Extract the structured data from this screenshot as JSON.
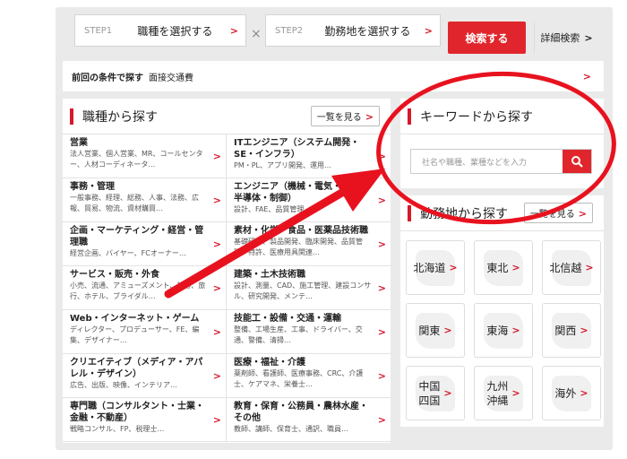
{
  "top": {
    "step1_no": "STEP1",
    "step1_label": "職種を選択する",
    "times": "×",
    "step2_no": "STEP2",
    "step2_label": "勤務地を選択する",
    "search": "検索する",
    "detail": "詳細検索"
  },
  "prev": {
    "label": "前回の条件で探す",
    "value": "面接交通費"
  },
  "jobs": {
    "title": "職種から探す",
    "more": "一覧を見る",
    "items": [
      {
        "name": "営業",
        "desc": "法人営業、個人営業、MR、コールセンター、人材コーディネータ…"
      },
      {
        "name": "ITエンジニア（システム開発・SE・インフラ）",
        "desc": "PM・PL、アプリ開発、運用…"
      },
      {
        "name": "事務・管理",
        "desc": "一般事務、経理、総務、人事、法務、広報、貿易、物流、資材購買…"
      },
      {
        "name": "エンジニア（機械・電気・電子・半導体・制御）",
        "desc": "設計、FAE、品質管理…"
      },
      {
        "name": "企画・マーケティング・経営・管理職",
        "desc": "経営企画、バイヤー、FCオーナー…"
      },
      {
        "name": "素材・化学・食品・医薬品技術職",
        "desc": "基礎研究、製品開発、臨床開発、品質管理、特許、医療用具関連…"
      },
      {
        "name": "サービス・販売・外食",
        "desc": "小売、流通、アミューズメント、美容、旅行、ホテル、ブライダル…"
      },
      {
        "name": "建築・土木技術職",
        "desc": "設計、測量、CAD、施工管理、建設コンサル、研究開発、メンテ…"
      },
      {
        "name": "Web・インターネット・ゲーム",
        "desc": "ディレクター、プロデューサー、FE、編集、デザイナー…"
      },
      {
        "name": "技能工・設備・交通・運輸",
        "desc": "整備、工場生産、工事、ドライバー、交通、警備、清掃…"
      },
      {
        "name": "クリエイティブ（メディア・アパレル・デザイン）",
        "desc": "広告、出版、映像、インテリア…"
      },
      {
        "name": "医療・福祉・介護",
        "desc": "薬剤師、看護師、医療事務、CRC、介護士、ケアマネ、栄養士…"
      },
      {
        "name": "専門職（コンサルタント・士業・金融・不動産）",
        "desc": "戦略コンサル、FP、税理士…"
      },
      {
        "name": "教育・保育・公務員・農林水産・その他",
        "desc": "教師、講師、保育士、通訳、職員…"
      }
    ]
  },
  "keyword": {
    "title": "キーワードから探す",
    "placeholder": "社名や職種、業種などを入力"
  },
  "area": {
    "title": "勤務地から探す",
    "more": "一覧を見る",
    "regions": [
      {
        "label": "北海道"
      },
      {
        "label": "東北"
      },
      {
        "label": "北信越"
      },
      {
        "label": "関東"
      },
      {
        "label": "東海"
      },
      {
        "label": "関西"
      },
      {
        "label": "中国\n四国"
      },
      {
        "label": "九州\n沖縄"
      },
      {
        "label": "海外"
      }
    ]
  },
  "icons": {
    "chevron": "chevron-right-icon",
    "search": "magnifier-icon"
  },
  "colors": {
    "accent": "#e0262c",
    "annotation": "#e8121f"
  }
}
